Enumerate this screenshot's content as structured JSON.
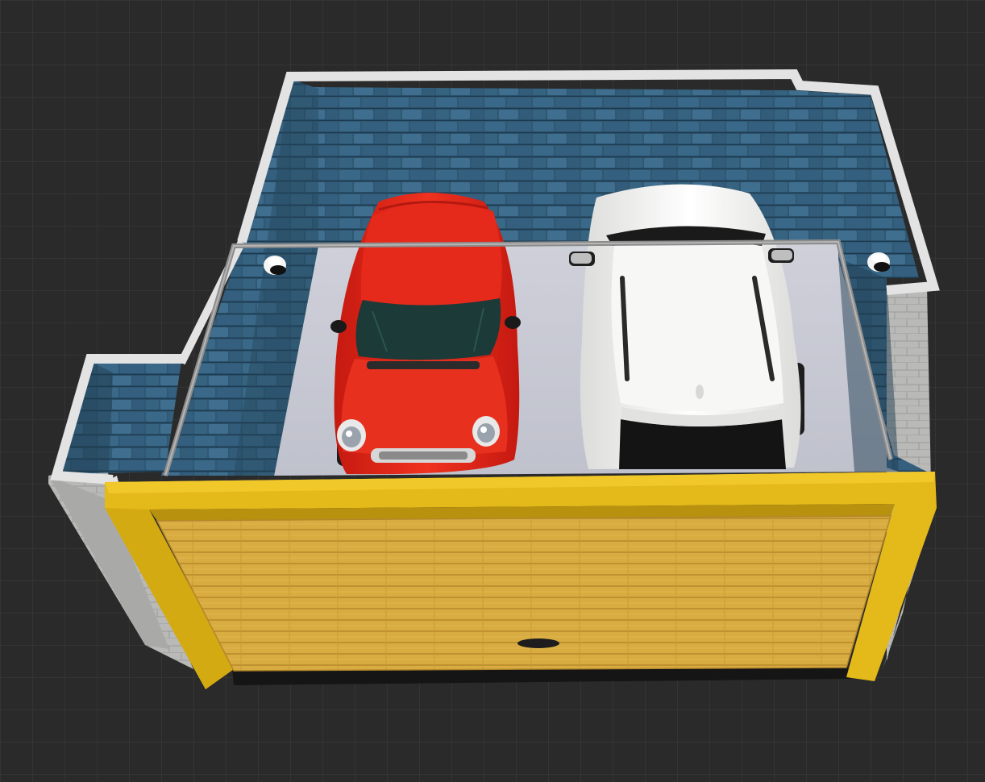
{
  "scene": {
    "kind": "3D garage floor plan view",
    "colors": {
      "background": "#2a2a2a",
      "grid_line": "#3a3a3a",
      "wall_stone": "#2f5873",
      "wall_stone_light": "#3f6d8c",
      "wall_top": "#e3e3e3",
      "exterior_wall": "#b8b8b8",
      "floor": "#c9cbd6",
      "door_frame": "#e4b91a",
      "door_panel": "#d7ab3d",
      "car_red": "#e3241b",
      "car_white": "#f4f4f2",
      "rail": "#8c8c8c"
    },
    "objects": [
      {
        "name": "red-hatchback",
        "color_name": "red"
      },
      {
        "name": "white-suv",
        "color_name": "white"
      },
      {
        "name": "garage-door",
        "state": "closed"
      },
      {
        "name": "wall-lamp-left"
      },
      {
        "name": "wall-lamp-right"
      }
    ]
  }
}
